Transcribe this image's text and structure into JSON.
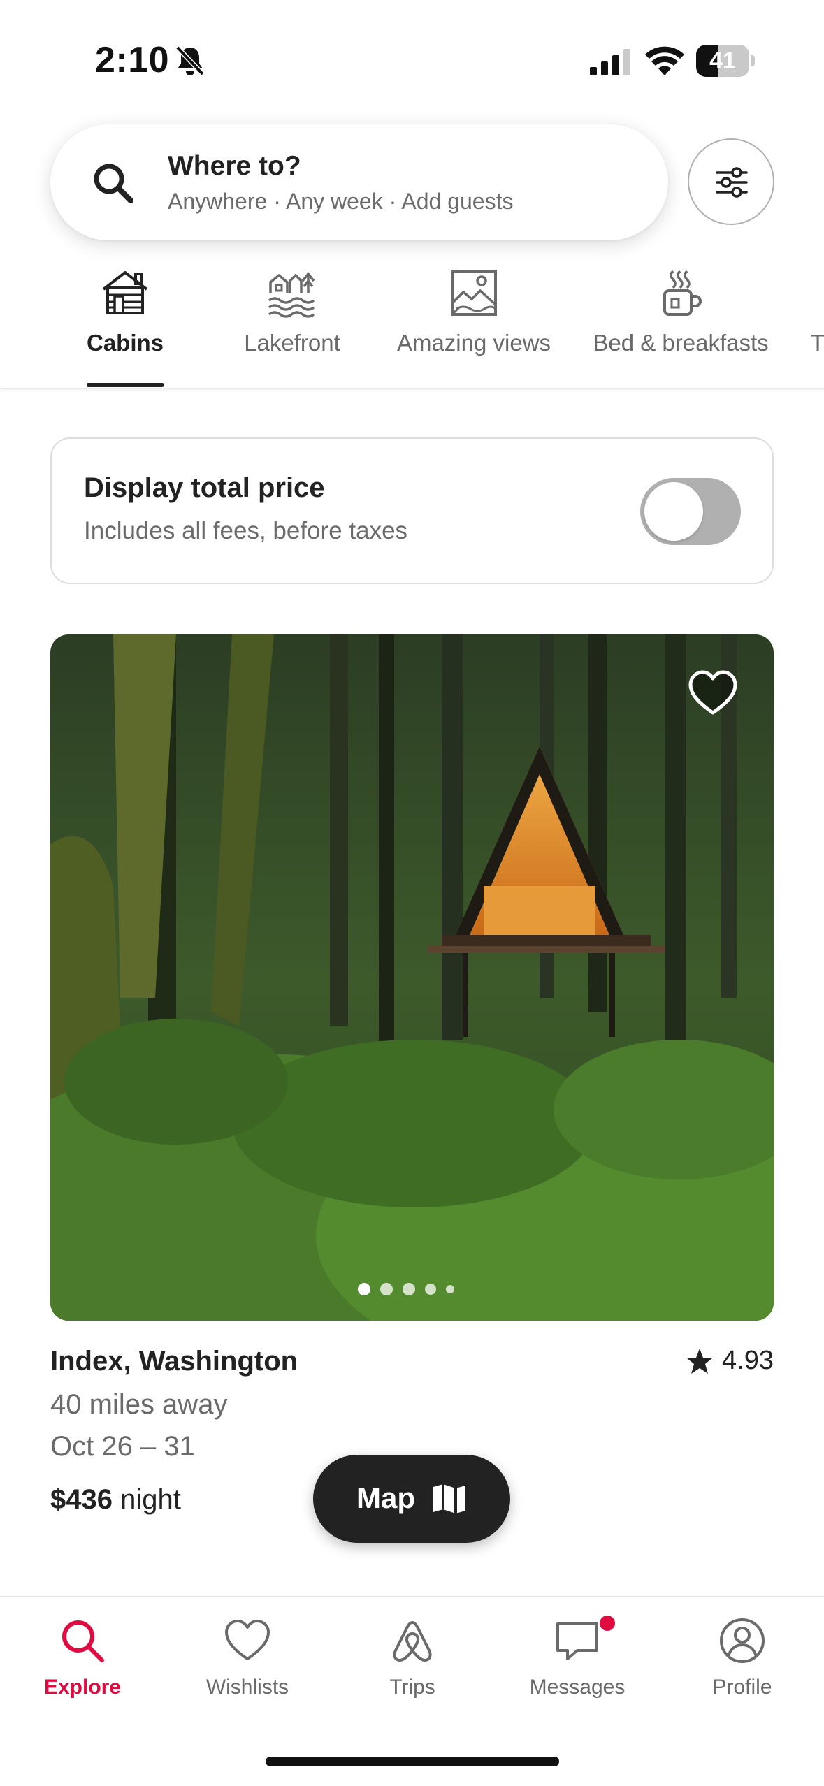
{
  "status_bar": {
    "time": "2:10",
    "battery": "41",
    "battery_fraction": 0.41
  },
  "search": {
    "title": "Where to?",
    "subtitle": "Anywhere · Any week · Add guests"
  },
  "categories": [
    {
      "label": "Cabins",
      "icon": "cabin-icon",
      "active": true
    },
    {
      "label": "Lakefront",
      "icon": "lakefront-icon",
      "active": false
    },
    {
      "label": "Amazing views",
      "icon": "amazing-views-icon",
      "active": false
    },
    {
      "label": "Bed & breakfasts",
      "icon": "bed-breakfast-icon",
      "active": false
    },
    {
      "label": "T",
      "icon": "",
      "active": false
    }
  ],
  "price_toggle": {
    "title": "Display total price",
    "subtitle": "Includes all fees, before taxes",
    "enabled": false
  },
  "listing": {
    "title": "Index, Washington",
    "rating": "4.93",
    "distance": "40 miles away",
    "dates": "Oct 26 – 31",
    "price_amount": "$436",
    "price_unit": " night",
    "photo_count_dots": 5,
    "active_photo": 0,
    "favorited": false
  },
  "map_button": {
    "label": "Map"
  },
  "tab_bar": [
    {
      "label": "Explore",
      "icon": "search-icon",
      "active": true
    },
    {
      "label": "Wishlists",
      "icon": "heart-icon",
      "active": false
    },
    {
      "label": "Trips",
      "icon": "airbnb-logo-icon",
      "active": false
    },
    {
      "label": "Messages",
      "icon": "message-icon",
      "active": false,
      "badge": true
    },
    {
      "label": "Profile",
      "icon": "profile-icon",
      "active": false
    }
  ],
  "colors": {
    "accent": "#e00b41",
    "text_primary": "#222222",
    "text_secondary": "#6a6a6a",
    "toggle_off": "#b0b0b0",
    "map_button_bg": "#222222"
  }
}
